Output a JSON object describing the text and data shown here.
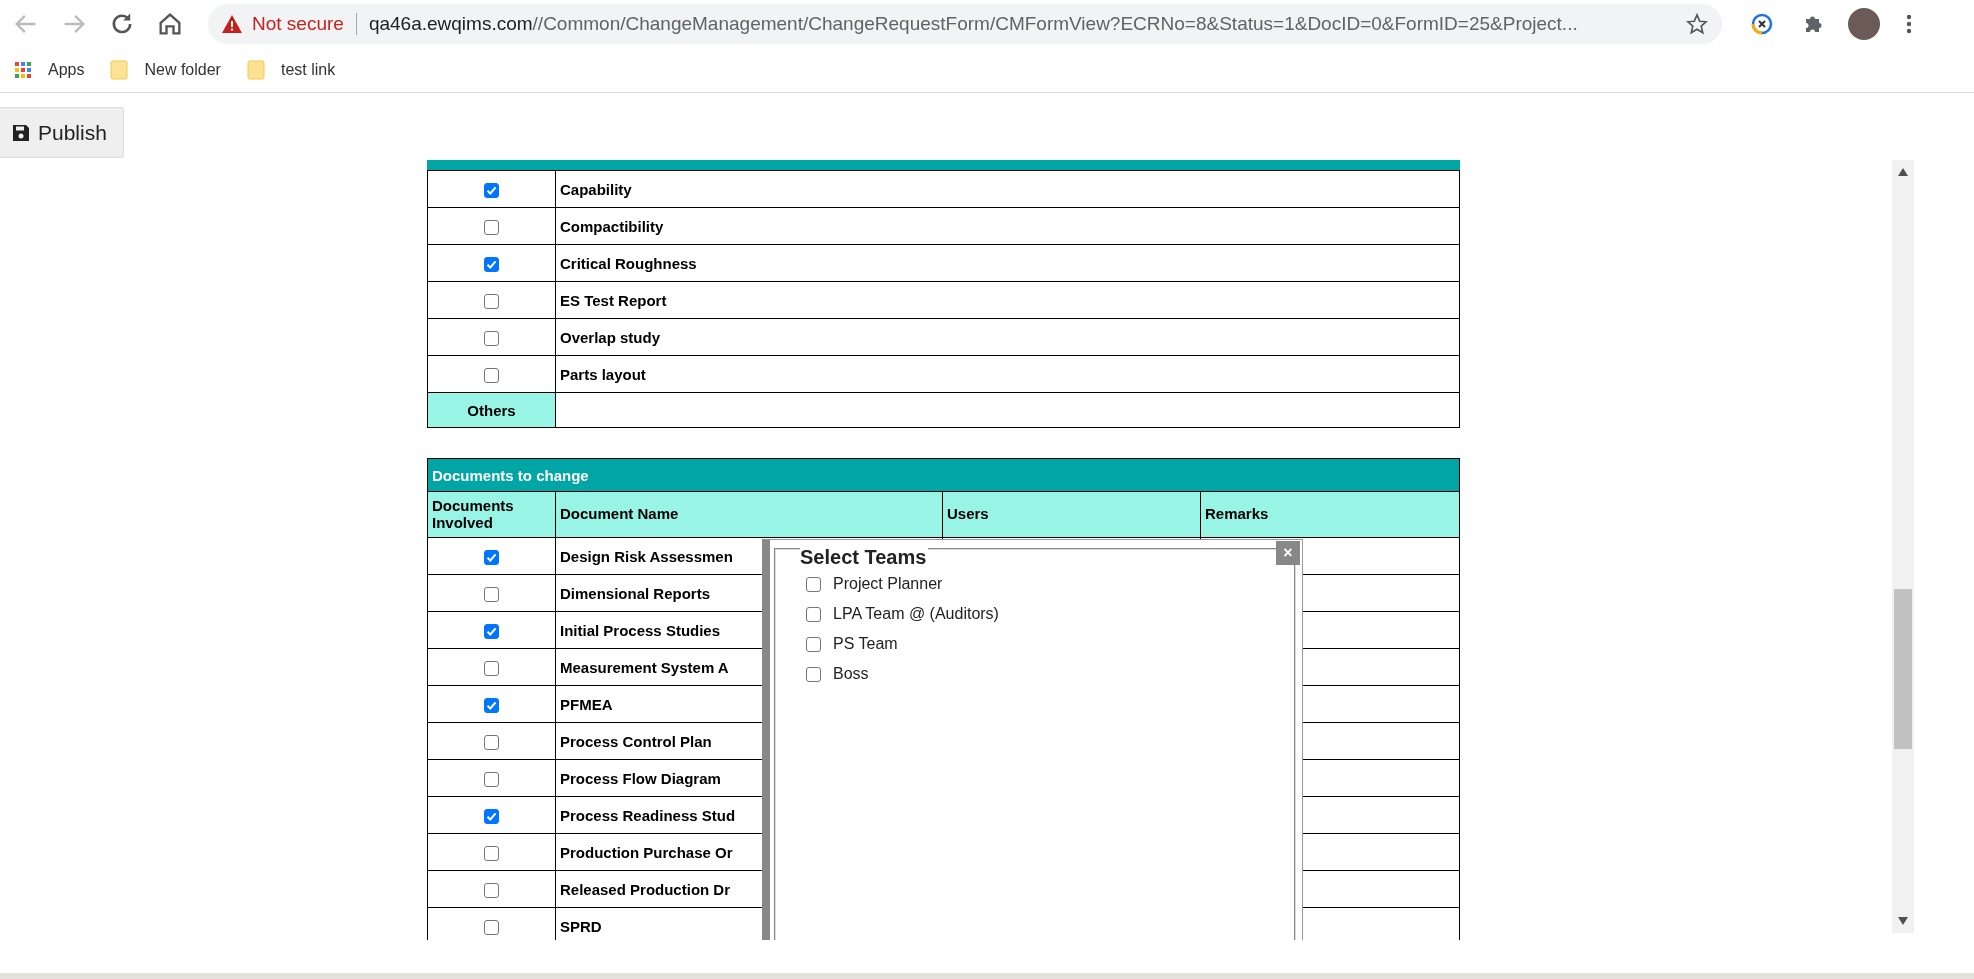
{
  "browser": {
    "security": "Not secure",
    "url_host": "qa46a.ewqims.com",
    "url_path": "//Common/ChangeManagement/ChangeRequestForm/CMFormView?ECRNo=8&Status=1&DocID=0&FormID=25&Project...",
    "bookmarks": [
      {
        "kind": "apps",
        "label": "Apps"
      },
      {
        "kind": "folder",
        "label": "New folder"
      },
      {
        "kind": "folder",
        "label": "test link"
      }
    ]
  },
  "toolbar": {
    "publish_button": "Publish"
  },
  "dimensions": {
    "items": [
      {
        "label": "Capability",
        "checked": true
      },
      {
        "label": "Compactibility",
        "checked": false
      },
      {
        "label": "Critical Roughness",
        "checked": true
      },
      {
        "label": "ES Test Report",
        "checked": false
      },
      {
        "label": "Overlap study",
        "checked": false
      },
      {
        "label": "Parts layout",
        "checked": false
      }
    ],
    "others_label": "Others"
  },
  "documents": {
    "title": "Documents to change",
    "columns": [
      "Documents Involved",
      "Document Name",
      "Users",
      "Remarks"
    ],
    "rows": [
      {
        "name": "Design Risk Assessmen",
        "checked": true
      },
      {
        "name": "Dimensional Reports",
        "checked": false
      },
      {
        "name": "Initial Process Studies",
        "checked": true
      },
      {
        "name": "Measurement System A",
        "checked": false
      },
      {
        "name": "PFMEA",
        "checked": true
      },
      {
        "name": "Process Control Plan",
        "checked": false
      },
      {
        "name": "Process Flow Diagram",
        "checked": false
      },
      {
        "name": "Process Readiness Stud",
        "checked": true
      },
      {
        "name": "Production Purchase Or",
        "checked": false
      },
      {
        "name": "Released Production Dr",
        "checked": false
      },
      {
        "name": "SPRD",
        "checked": false
      }
    ]
  },
  "select_teams": {
    "title": "Select Teams",
    "close": "×",
    "teams": [
      {
        "label": "Project Planner",
        "checked": false
      },
      {
        "label": "LPA Team @ (Auditors)",
        "checked": false
      },
      {
        "label": "PS Team",
        "checked": false
      },
      {
        "label": "Boss",
        "checked": false
      }
    ]
  }
}
